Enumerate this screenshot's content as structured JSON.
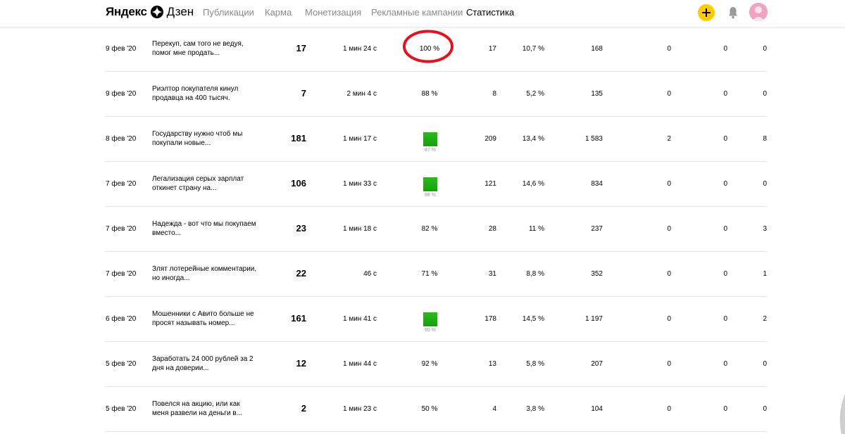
{
  "header": {
    "logo_word1": "Яндекс",
    "logo_word2": "Дзен",
    "nav": [
      {
        "label": "Публикации",
        "active": false
      },
      {
        "label": "Карма",
        "active": false
      },
      {
        "label": "Монетизация",
        "active": false
      },
      {
        "label": "Рекламные кампании",
        "active": false
      },
      {
        "label": "Статистика",
        "active": true
      }
    ],
    "plus_icon": "plus-icon",
    "bell_icon": "bell-icon",
    "accent_color": "#ffcc00"
  },
  "rows": [
    {
      "date": "9 фев '20",
      "title": "Перекуп, сам того не ведуя, помог мне продать...",
      "views": "17",
      "time": "1 мин 24 с",
      "pct": "100 %",
      "read": "17",
      "ctr": "10,7 %",
      "shows": "168",
      "likes": "0",
      "comments": "0",
      "subs": "0",
      "bar": false,
      "highlighted": true
    },
    {
      "date": "9 фев '20",
      "title": "Риэлтор покупателя кинул продавца на 400 тысяч.",
      "views": "7",
      "time": "2 мин 4 с",
      "pct": "88 %",
      "read": "8",
      "ctr": "5,2 %",
      "shows": "135",
      "likes": "0",
      "comments": "0",
      "subs": "0",
      "bar": false
    },
    {
      "date": "8 фев '20",
      "title": "Государству нужно чтоб мы покупали новые...",
      "views": "181",
      "time": "1 мин 17 с",
      "pct": "87 %",
      "read": "209",
      "ctr": "13,4 %",
      "shows": "1 583",
      "likes": "2",
      "comments": "0",
      "subs": "8",
      "bar": true
    },
    {
      "date": "7 фев '20",
      "title": "Легализация серых зарплат откинет страну на...",
      "views": "106",
      "time": "1 мин 33 с",
      "pct": "88 %",
      "read": "121",
      "ctr": "14,6 %",
      "shows": "834",
      "likes": "0",
      "comments": "0",
      "subs": "0",
      "bar": true
    },
    {
      "date": "7 фев '20",
      "title": "Надежда - вот что мы покупаем вместо...",
      "views": "23",
      "time": "1 мин 18 с",
      "pct": "82 %",
      "read": "28",
      "ctr": "11 %",
      "shows": "237",
      "likes": "0",
      "comments": "0",
      "subs": "3",
      "bar": false
    },
    {
      "date": "7 фев '20",
      "title": "Злят лотерейные комментарии, но иногда...",
      "views": "22",
      "time": "46 с",
      "pct": "71 %",
      "read": "31",
      "ctr": "8,8 %",
      "shows": "352",
      "likes": "0",
      "comments": "0",
      "subs": "1",
      "bar": false
    },
    {
      "date": "6 фев '20",
      "title": "Мошенники с Авито больше не просят называть номер...",
      "views": "161",
      "time": "1 мин 41 с",
      "pct": "90 %",
      "read": "178",
      "ctr": "14,5 %",
      "shows": "1 197",
      "likes": "0",
      "comments": "0",
      "subs": "2",
      "bar": true
    },
    {
      "date": "5 фев '20",
      "title": "Заработать 24 000 рублей за 2 дня на доверии...",
      "views": "12",
      "time": "1 мин 44 с",
      "pct": "92 %",
      "read": "13",
      "ctr": "5,8 %",
      "shows": "207",
      "likes": "0",
      "comments": "0",
      "subs": "0",
      "bar": false
    },
    {
      "date": "5 фев '20",
      "title": "Повелся на акцию, или как меня развели на деньги в...",
      "views": "2",
      "time": "1 мин 23 с",
      "pct": "50 %",
      "read": "4",
      "ctr": "3,8 %",
      "shows": "104",
      "likes": "0",
      "comments": "0",
      "subs": "0",
      "bar": false
    }
  ],
  "highlight_color": "#e0141e",
  "bar_color": "#1aa70e"
}
